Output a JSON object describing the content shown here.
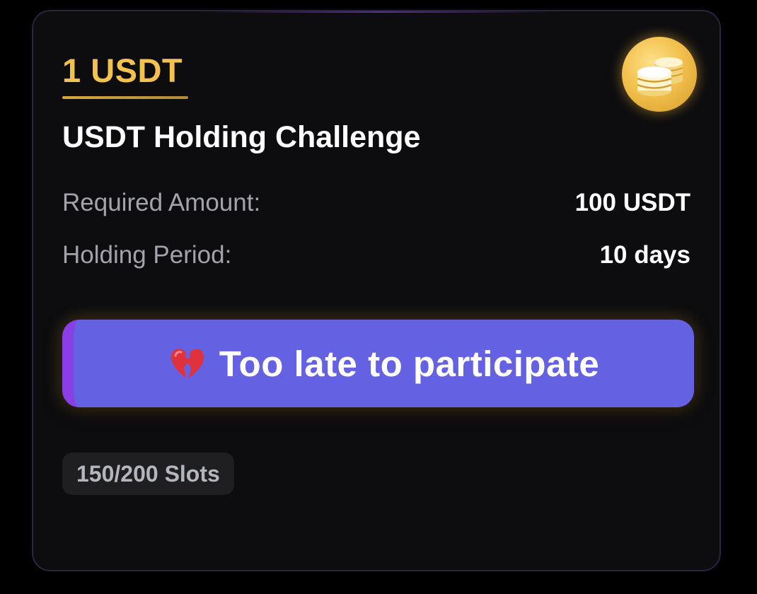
{
  "card": {
    "reward": "1 USDT",
    "reward_icon": "gold-coins-icon",
    "title": "USDT Holding Challenge",
    "details": [
      {
        "label": "Required Amount:",
        "value": "100 USDT"
      },
      {
        "label": "Holding Period:",
        "value": "10 days"
      }
    ],
    "action": {
      "icon": "broken-heart-icon",
      "label": "Too late to participate"
    },
    "slots": "150/200 Slots"
  },
  "colors": {
    "background": "#000000",
    "card": "#0d0d0f",
    "reward": "#f2c14e",
    "button": "#6462e2",
    "button_accent": "#8a3fe6",
    "label": "#a3a3ab"
  }
}
